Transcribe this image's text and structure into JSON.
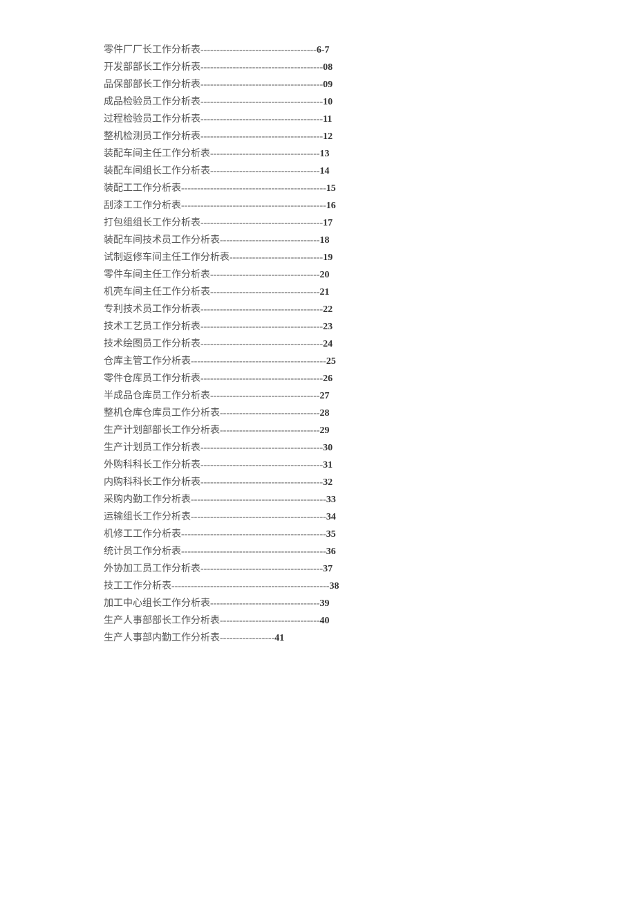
{
  "toc": [
    {
      "title": "零件厂厂长工作分析表 ",
      "leader": "------------------------------------",
      "page": "6-7"
    },
    {
      "title": "开发部部长工作分析表 ",
      "leader": "--------------------------------------",
      "page": "08"
    },
    {
      "title": "品保部部长工作分析表 ",
      "leader": "--------------------------------------",
      "page": "09"
    },
    {
      "title": "成品检验员工作分析表 ",
      "leader": "--------------------------------------",
      "page": "10"
    },
    {
      "title": "过程检验员工作分析表 ",
      "leader": "--------------------------------------",
      "page": "11"
    },
    {
      "title": "整机检测员工作分析表 ",
      "leader": "--------------------------------------",
      "page": "12"
    },
    {
      "title": "装配车间主任工作分析表 ",
      "leader": "----------------------------------",
      "page": "13"
    },
    {
      "title": "装配车间组长工作分析表 ",
      "leader": "----------------------------------",
      "page": "14"
    },
    {
      "title": "装配工工作分析表 ",
      "leader": "---------------------------------------------",
      "page": "15"
    },
    {
      "title": "刮漆工工作分析表 ",
      "leader": "---------------------------------------------",
      "page": "16"
    },
    {
      "title": "打包组组长工作分析表 ",
      "leader": "--------------------------------------",
      "page": "17"
    },
    {
      "title": "装配车间技术员工作分析表 ",
      "leader": "-------------------------------",
      "page": "18"
    },
    {
      "title": "试制返修车间主任工作分析表 ",
      "leader": "-----------------------------",
      "page": "19"
    },
    {
      "title": "零件车间主任工作分析表 ",
      "leader": "----------------------------------",
      "page": "20"
    },
    {
      "title": "机壳车间主任工作分析表 ",
      "leader": "----------------------------------",
      "page": "21"
    },
    {
      "title": "专利技术员工作分析表 ",
      "leader": "--------------------------------------",
      "page": "22"
    },
    {
      "title": "技术工艺员工作分析表 ",
      "leader": "--------------------------------------",
      "page": "23"
    },
    {
      "title": "技术绘图员工作分析表 ",
      "leader": "--------------------------------------",
      "page": "24"
    },
    {
      "title": "仓库主管工作分析表 ",
      "leader": "------------------------------------------",
      "page": "25"
    },
    {
      "title": "零件仓库员工作分析表 ",
      "leader": "--------------------------------------",
      "page": "26"
    },
    {
      "title": "半成品仓库员工作分析表 ",
      "leader": "----------------------------------",
      "page": "27"
    },
    {
      "title": "整机仓库仓库员工作分析表 ",
      "leader": "-------------------------------",
      "page": "28"
    },
    {
      "title": "生产计划部部长工作分析表 ",
      "leader": "-------------------------------",
      "page": "29"
    },
    {
      "title": "生产计划员工作分析表 ",
      "leader": "--------------------------------------",
      "page": "30"
    },
    {
      "title": "外购科科长工作分析表 ",
      "leader": "--------------------------------------",
      "page": "31"
    },
    {
      "title": "内购科科长工作分析表 ",
      "leader": "--------------------------------------",
      "page": "32"
    },
    {
      "title": "采购内勤工作分析表 ",
      "leader": "------------------------------------------",
      "page": "33"
    },
    {
      "title": "运输组长工作分析表 ",
      "leader": "------------------------------------------",
      "page": "34"
    },
    {
      "title": "机修工工作分析表 ",
      "leader": "---------------------------------------------",
      "page": "35"
    },
    {
      "title": "统计员工作分析表 ",
      "leader": "---------------------------------------------",
      "page": "36"
    },
    {
      "title": "外协加工员工作分析表 ",
      "leader": "--------------------------------------",
      "page": "37"
    },
    {
      "title": "技工工作分析表 ",
      "leader": "-------------------------------------------------",
      "page": "38"
    },
    {
      "title": "加工中心组长工作分析表 ",
      "leader": "----------------------------------",
      "page": "39"
    },
    {
      "title": "生产人事部部长工作分析表 ",
      "leader": "-------------------------------",
      "page": "40"
    },
    {
      "title": "生产人事部内勤工作分析表 ",
      "leader": "-----------------",
      "page": "41",
      "last": true
    }
  ]
}
